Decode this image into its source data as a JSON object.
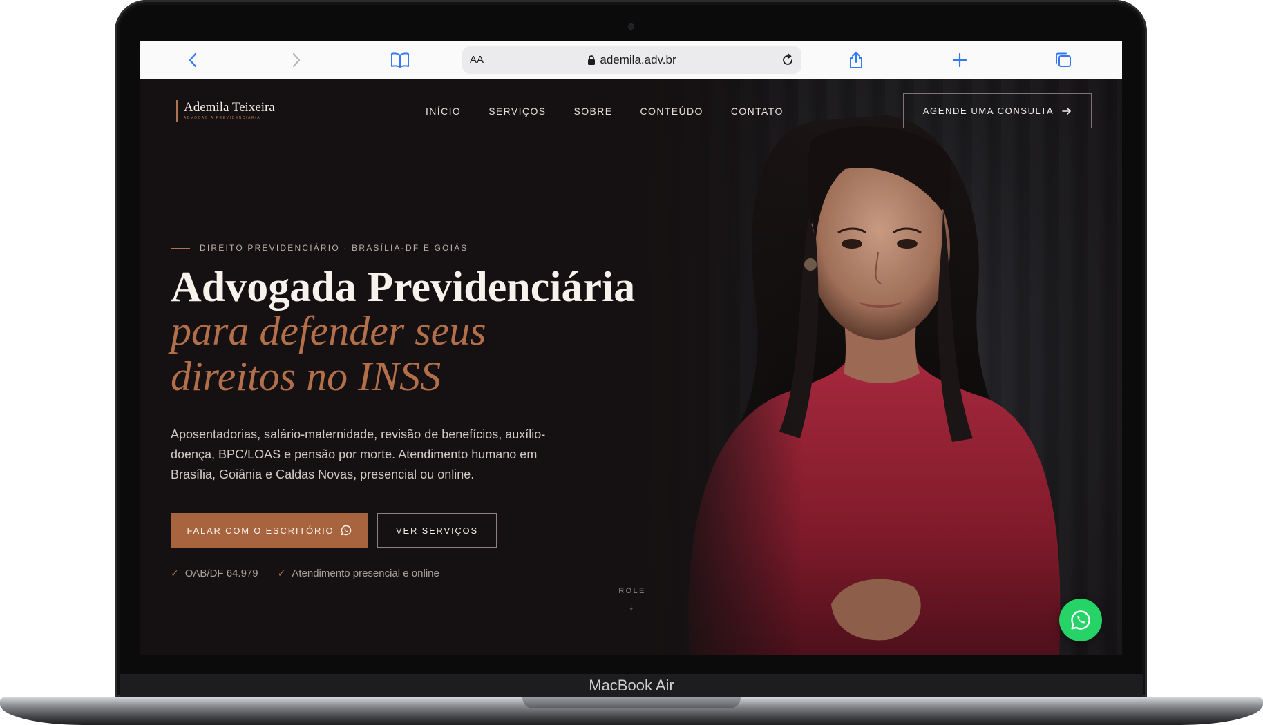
{
  "device": {
    "label": "MacBook Air"
  },
  "browser": {
    "text_size_label": "AA",
    "url": "ademila.adv.br"
  },
  "site": {
    "logo": {
      "name": "Ademila Teixeira",
      "subtitle": "ADVOCACIA PREVIDENCIÁRIA"
    },
    "nav": [
      {
        "label": "INÍCIO"
      },
      {
        "label": "SERVIÇOS"
      },
      {
        "label": "SOBRE"
      },
      {
        "label": "CONTEÚDO"
      },
      {
        "label": "CONTATO"
      }
    ],
    "cta_top": {
      "label": "AGENDE UMA CONSULTA",
      "icon": "arrow-right-icon"
    },
    "hero": {
      "eyebrow": "DIREITO PREVIDENCIÁRIO · BRASÍLIA-DF E GOIÁS",
      "title_line1": "Advogada Previdenciária",
      "title_accent": "para defender seus direitos no INSS",
      "lead": "Aposentadorias, salário-maternidade, revisão de benefícios, auxílio-doença, BPC/LOAS e pensão por morte. Atendimento humano em Brasília, Goiânia e Caldas Novas, presencial ou online.",
      "primary_button": {
        "label": "FALAR COM O ESCRITÓRIO",
        "icon": "whatsapp-icon"
      },
      "secondary_button": {
        "label": "VER SERVIÇOS"
      },
      "checks": [
        {
          "label": "OAB/DF 64.979"
        },
        {
          "label": "Atendimento presencial e online"
        }
      ],
      "scroll_hint": "ROLE"
    },
    "colors": {
      "background": "#151112",
      "accent": "#b36e4a",
      "button": "#a8643f",
      "whatsapp": "#25d366"
    }
  }
}
